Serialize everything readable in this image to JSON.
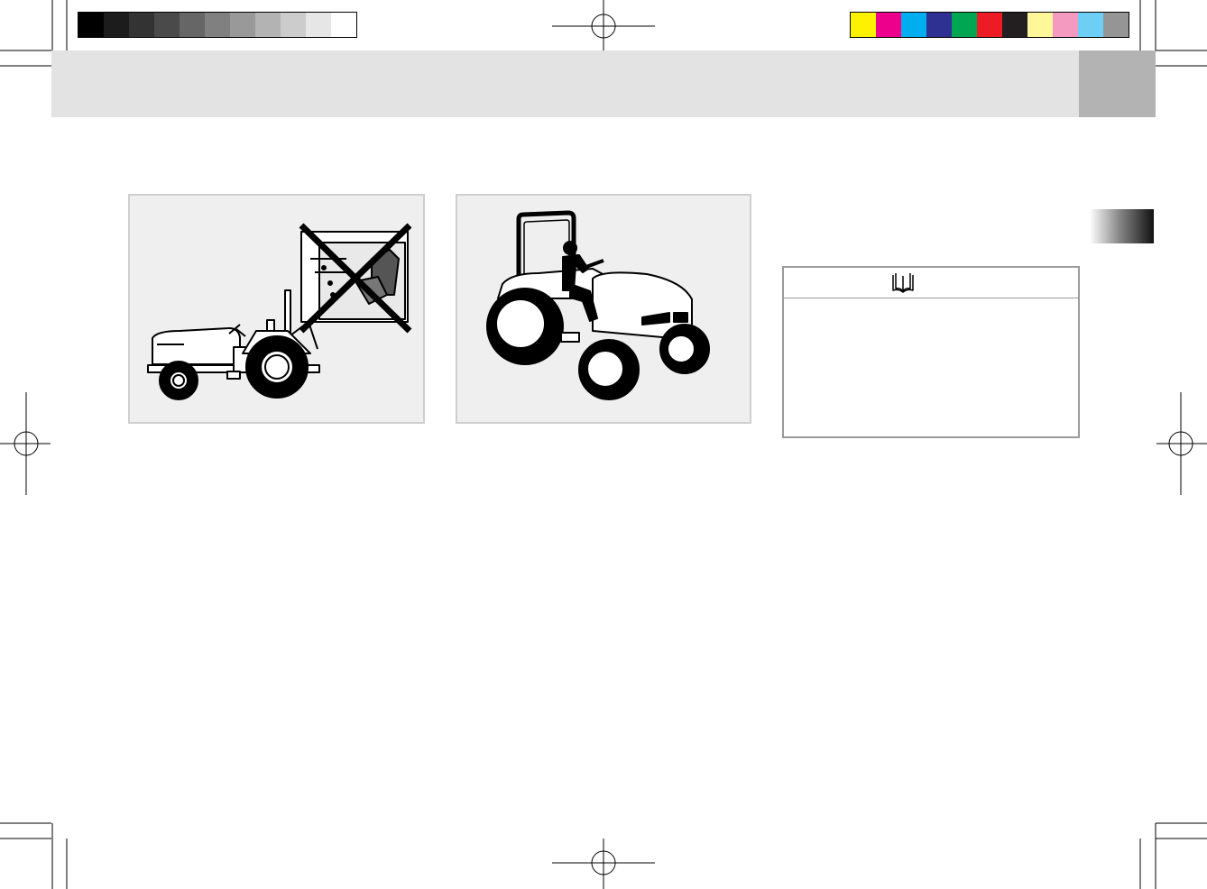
{
  "color_bars": {
    "grayscale": [
      "#000000",
      "#1c1c1c",
      "#333333",
      "#4a4a4a",
      "#666666",
      "#808080",
      "#999999",
      "#b3b3b3",
      "#cccccc",
      "#e6e6e6",
      "#ffffff"
    ],
    "process": [
      "#fff200",
      "#ec008c",
      "#00aeef",
      "#2e3192",
      "#00a651",
      "#ed1c24",
      "#231f20",
      "#fff799",
      "#f49ac1",
      "#6dcff6",
      "#959595"
    ]
  },
  "header": {
    "band_color": "#e3e3e3",
    "tab_color": "#b3b3b3"
  },
  "figures": [
    {
      "id": "prohibited",
      "icon": "tractor-with-cab-prohibited-icon",
      "mark": "cross-icon"
    },
    {
      "id": "correct",
      "icon": "tractor-with-rops-operator-icon"
    }
  ],
  "note_box": {
    "icon": "open-book-icon",
    "text": ""
  }
}
